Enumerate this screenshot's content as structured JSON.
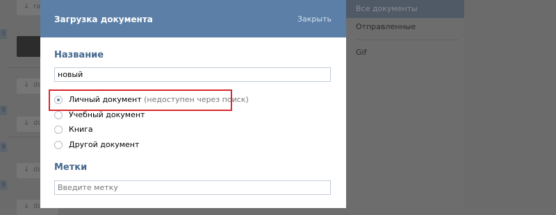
{
  "background": {
    "left_items": [
      {
        "text": "ra"
      },
      {
        "text": "do"
      },
      {
        "text": "do"
      },
      {
        "text": "do"
      },
      {
        "text": "do"
      }
    ],
    "left_numbers": [
      "5",
      "9",
      "9",
      "9"
    ]
  },
  "modal": {
    "title": "Загрузка документа",
    "close_label": "Закрыть",
    "name_section": {
      "title": "Название",
      "value": "новый"
    },
    "doc_types": [
      {
        "label": "Личный документ",
        "hint": " (недоступен через поиск)",
        "checked": true
      },
      {
        "label": "Учебный документ",
        "hint": "",
        "checked": false
      },
      {
        "label": "Книга",
        "hint": "",
        "checked": false
      },
      {
        "label": "Другой документ",
        "hint": "",
        "checked": false
      }
    ],
    "tags_section": {
      "title": "Метки",
      "placeholder": "Введите метку"
    }
  },
  "right_panel": {
    "items": [
      {
        "label": "Все документы",
        "active": true
      },
      {
        "label": "Отправленные",
        "active": false
      },
      {
        "label": "Gif",
        "active": false
      }
    ]
  },
  "colors": {
    "header_bg": "#5b7fa6",
    "section_title": "#45688e",
    "highlight_border": "#d9262b"
  }
}
